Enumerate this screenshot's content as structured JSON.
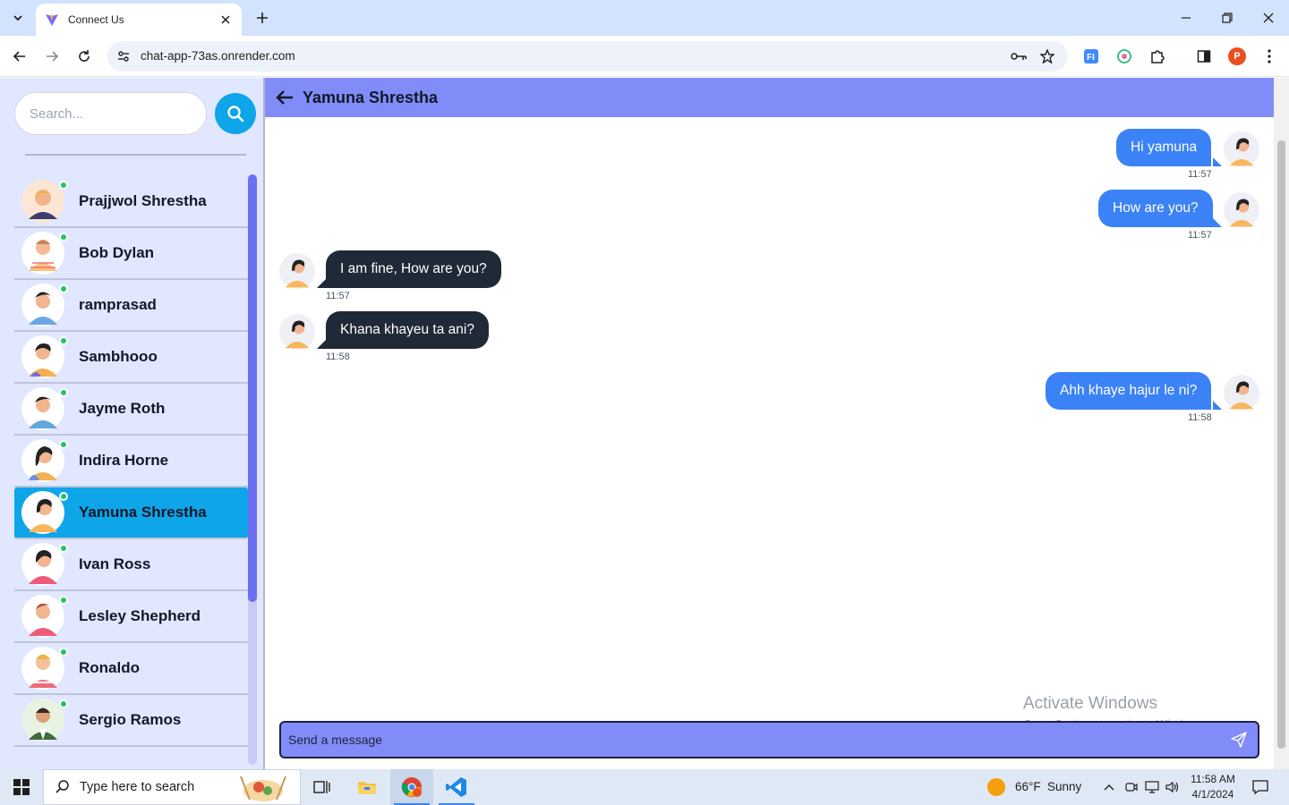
{
  "browser": {
    "tab_title": "Connect Us",
    "url": "chat-app-73as.onrender.com",
    "profile_initial": "P"
  },
  "sidebar": {
    "search_placeholder": "Search...",
    "contacts": [
      {
        "name": "Prajjwol Shrestha",
        "online": true
      },
      {
        "name": "Bob Dylan",
        "online": true
      },
      {
        "name": "ramprasad",
        "online": true
      },
      {
        "name": "Sambhooo",
        "online": true
      },
      {
        "name": "Jayme Roth",
        "online": true
      },
      {
        "name": "Indira Horne",
        "online": true
      },
      {
        "name": "Yamuna Shrestha",
        "online": true,
        "active": true
      },
      {
        "name": "Ivan Ross",
        "online": true
      },
      {
        "name": "Lesley Shepherd",
        "online": true
      },
      {
        "name": "Ronaldo",
        "online": true
      },
      {
        "name": "Sergio Ramos",
        "online": true
      }
    ]
  },
  "chat": {
    "title": "Yamuna Shrestha",
    "messages": [
      {
        "text": "Hi yamuna",
        "time": "11:57",
        "direction": "sent"
      },
      {
        "text": "How are you?",
        "time": "11:57",
        "direction": "sent"
      },
      {
        "text": "I am fine, How are you?",
        "time": "11:57",
        "direction": "received"
      },
      {
        "text": "Khana khayeu ta ani?",
        "time": "11:58",
        "direction": "received"
      },
      {
        "text": "Ahh khaye hajur le ni?",
        "time": "11:58",
        "direction": "sent"
      }
    ],
    "composer_placeholder": "Send a message"
  },
  "watermark": {
    "title": "Activate Windows",
    "subtitle": "Go to Settings to activate Windows."
  },
  "taskbar": {
    "search_text": "Type here to search",
    "weather_temp": "66°F",
    "weather_desc": "Sunny",
    "time": "11:58 AM",
    "date": "4/1/2024"
  },
  "colors": {
    "header_bg": "#818cf8",
    "sidebar_bg": "#e0e7ff",
    "active_contact": "#0ea5e9",
    "sent_bubble": "#3b82f6",
    "received_bubble": "#1f2937",
    "online": "#22c55e"
  }
}
